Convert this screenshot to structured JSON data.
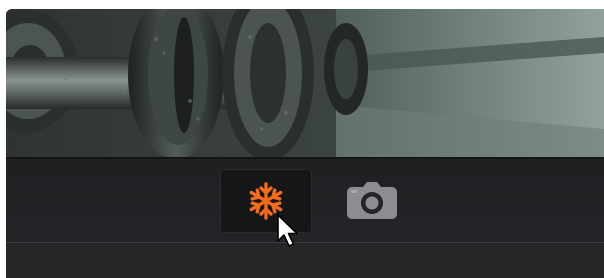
{
  "viewer": {
    "content": "image-preview"
  },
  "toolbar": {
    "buttons": [
      {
        "name": "freeze",
        "icon": "snowflake-icon",
        "color": "#f26a1b",
        "active": true
      },
      {
        "name": "snapshot",
        "icon": "camera-icon",
        "color": "#8c8d90",
        "active": false
      }
    ]
  },
  "colors": {
    "accent": "#f26a1b",
    "panel": "#222325",
    "icon_inactive": "#8c8d90"
  },
  "cursor": {
    "icon": "arrow-cursor-icon"
  }
}
